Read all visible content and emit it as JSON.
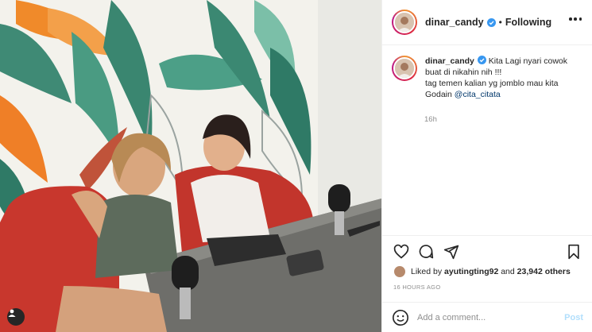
{
  "post": {
    "username": "dinar_candy",
    "follow_status": "Following",
    "separator": "•",
    "caption": {
      "line1": "Kita Lagi nyari cowok buat di nikahin nih !!!",
      "line2": "tag temen kalian yg jomblo mau kita Godain",
      "mention": "@cita_citata"
    },
    "caption_age": "16h",
    "likes": {
      "prefix": "Liked by",
      "liked_by_user": "ayutingting92",
      "and_text": "and",
      "others": "23,942 others"
    },
    "timestamp": "16 HOURS AGO",
    "comment_placeholder": "Add a comment...",
    "post_label": "Post"
  },
  "icons": {
    "verified": "verified-badge-icon",
    "more": "more-options-icon",
    "like": "heart-icon",
    "comment": "comment-icon",
    "share": "paper-plane-icon",
    "save": "bookmark-icon",
    "emoji": "emoji-icon",
    "tagged": "user-tag-icon"
  },
  "colors": {
    "verified_blue": "#3897f0",
    "post_button_disabled": "#b2dffc",
    "mention_blue": "#00376b"
  }
}
